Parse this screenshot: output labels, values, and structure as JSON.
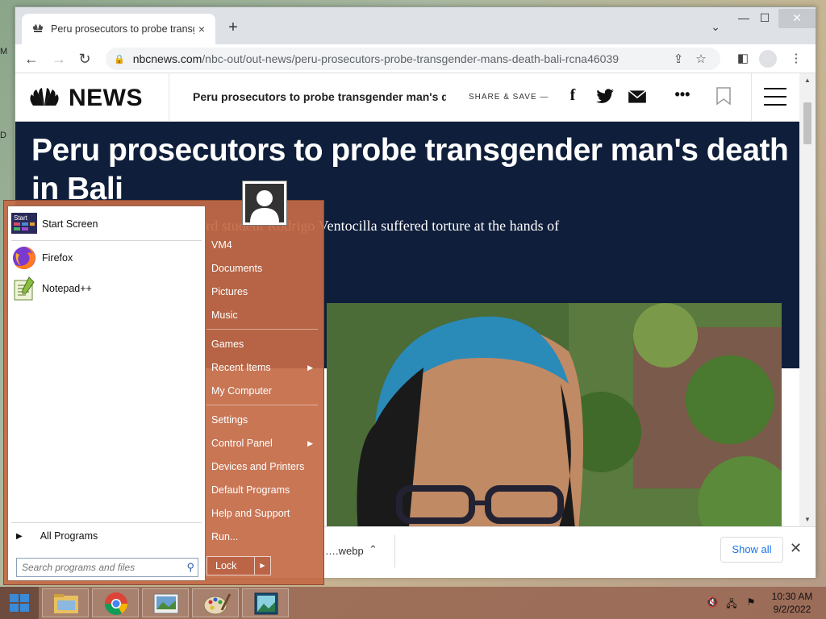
{
  "desktop": {
    "frag1": "M",
    "frag2": "D"
  },
  "browser": {
    "tab": {
      "title": "Peru prosecutors to probe transgender man's death in Bali",
      "close": "×"
    },
    "new_tab": "+",
    "window_controls": {
      "minimize": "—",
      "maximize": "☐",
      "close": "✕"
    },
    "url_host": "nbcnews.com",
    "url_path": "/nbc-out/out-news/peru-prosecutors-probe-transgender-mans-death-bali-rcna46039"
  },
  "page": {
    "logo_text": "NEWS",
    "header_title": "Peru prosecutors to probe transgender man's death in Bali",
    "share_label": "SHARE & SAVE —",
    "headline": "Peru prosecutors to probe transgender man's death in Bali",
    "dek": "…alleges that Peruvian Harvard student Rodrigo Ventocilla suffered torture at the hands of"
  },
  "download_bar": {
    "file": "….webp",
    "show_all": "Show all"
  },
  "start_menu": {
    "left_items": [
      {
        "label": "Start Screen",
        "icon": "start-screen-icon",
        "badge": "Start"
      },
      {
        "label": "Firefox",
        "icon": "firefox-icon"
      },
      {
        "label": "Notepad++",
        "icon": "notepadpp-icon"
      }
    ],
    "all_programs": "All Programs",
    "search_placeholder": "Search programs and files",
    "right_items": [
      {
        "label": "VM4"
      },
      {
        "label": "Documents"
      },
      {
        "label": "Pictures"
      },
      {
        "label": "Music"
      },
      {
        "label": "Games"
      },
      {
        "label": "Recent Items",
        "submenu": true
      },
      {
        "label": "My Computer"
      },
      {
        "label": "Settings"
      },
      {
        "label": "Control Panel",
        "submenu": true
      },
      {
        "label": "Devices and Printers"
      },
      {
        "label": "Default Programs"
      },
      {
        "label": "Help and Support"
      },
      {
        "label": "Run..."
      }
    ],
    "lock_label": "Lock"
  },
  "taskbar": {
    "apps": [
      "file-explorer-icon",
      "chrome-icon",
      "photos-icon",
      "paint-icon",
      "image-viewer-icon"
    ],
    "time": "10:30 AM",
    "date": "9/2/2022"
  }
}
